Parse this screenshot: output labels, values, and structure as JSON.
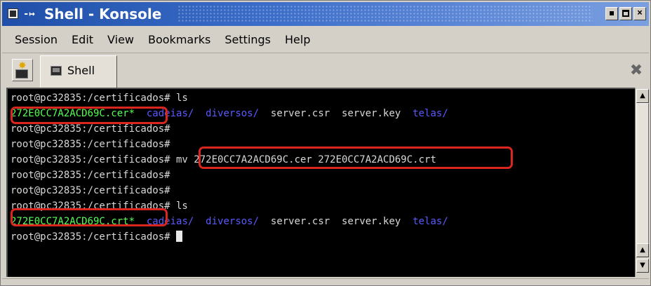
{
  "window": {
    "title": "Shell - Konsole",
    "sticky_glyph": "-↦",
    "buttons": [
      "minimize",
      "maximize",
      "close"
    ],
    "close_glyph": "×"
  },
  "menubar": {
    "items": [
      "Session",
      "Edit",
      "View",
      "Bookmarks",
      "Settings",
      "Help"
    ]
  },
  "tabbar": {
    "new_session_icon": "new-session-icon",
    "tabs": [
      {
        "label": "Shell",
        "icon": "terminal-icon",
        "active": true
      }
    ],
    "close_session_icon": "close-session-icon",
    "close_glyph": "✖"
  },
  "terminal": {
    "colors": {
      "background": "#000000",
      "text": "#d8d8d8",
      "executable": "#54ff54",
      "directory": "#5a5aff",
      "highlight": "#d9271f"
    },
    "lines": [
      [
        {
          "t": "root@pc32835:/certificados# ls",
          "c": "white"
        }
      ],
      [
        {
          "t": "272E0CC7A2ACD69C.cer*",
          "c": "green"
        },
        {
          "t": "  ",
          "c": "white"
        },
        {
          "t": "cadeias/",
          "c": "blue"
        },
        {
          "t": "  ",
          "c": "white"
        },
        {
          "t": "diversos/",
          "c": "blue"
        },
        {
          "t": "  server.csr  server.key  ",
          "c": "white"
        },
        {
          "t": "telas/",
          "c": "blue"
        }
      ],
      [
        {
          "t": "root@pc32835:/certificados#",
          "c": "white"
        }
      ],
      [
        {
          "t": "root@pc32835:/certificados#",
          "c": "white"
        }
      ],
      [
        {
          "t": "root@pc32835:/certificados# mv 272E0CC7A2ACD69C.cer 272E0CC7A2ACD69C.crt",
          "c": "white"
        }
      ],
      [
        {
          "t": "root@pc32835:/certificados#",
          "c": "white"
        }
      ],
      [
        {
          "t": "root@pc32835:/certificados#",
          "c": "white"
        }
      ],
      [
        {
          "t": "root@pc32835:/certificados# ls",
          "c": "white"
        }
      ],
      [
        {
          "t": "272E0CC7A2ACD69C.crt*",
          "c": "green"
        },
        {
          "t": "  ",
          "c": "white"
        },
        {
          "t": "cadeias/",
          "c": "blue"
        },
        {
          "t": "  ",
          "c": "white"
        },
        {
          "t": "diversos/",
          "c": "blue"
        },
        {
          "t": "  server.csr  server.key  ",
          "c": "white"
        },
        {
          "t": "telas/",
          "c": "blue"
        }
      ],
      [
        {
          "t": "root@pc32835:/certificados# ",
          "c": "white"
        }
      ]
    ],
    "cursor_line": 9
  },
  "scrollbar": {
    "up_glyph": "▲",
    "down_glyph": "▼"
  }
}
